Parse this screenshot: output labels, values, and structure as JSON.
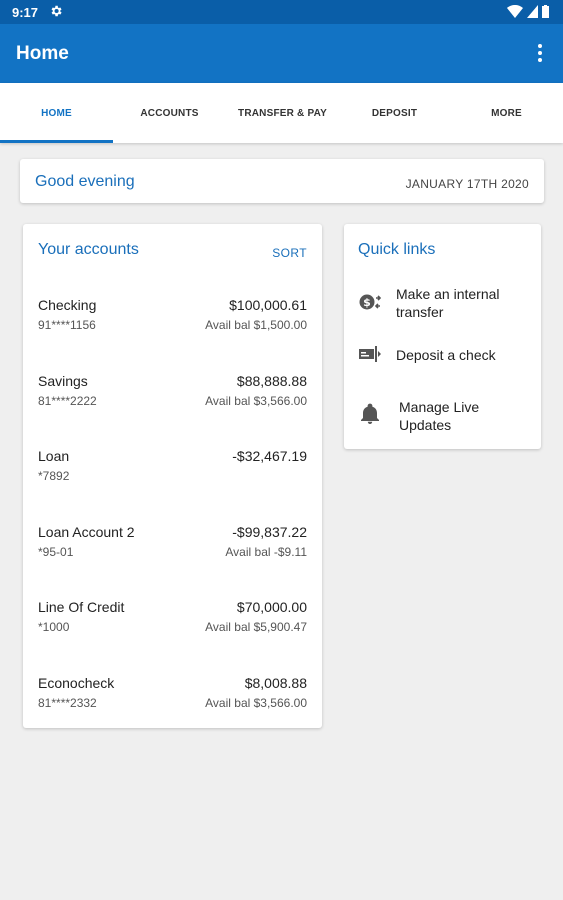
{
  "status_bar": {
    "time": "9:17"
  },
  "app_bar": {
    "title": "Home"
  },
  "tabs": [
    {
      "label": "HOME"
    },
    {
      "label": "ACCOUNTS"
    },
    {
      "label": "TRANSFER & PAY"
    },
    {
      "label": "DEPOSIT"
    },
    {
      "label": "MORE"
    }
  ],
  "greeting": {
    "text": "Good evening",
    "date": "JANUARY 17TH 2020"
  },
  "accounts": {
    "title": "Your accounts",
    "sort_label": "SORT",
    "items": [
      {
        "name": "Checking",
        "number": "91****1156",
        "amount": "$100,000.61",
        "available": "Avail bal $1,500.00"
      },
      {
        "name": "Savings",
        "number": "81****2222",
        "amount": "$88,888.88",
        "available": "Avail bal $3,566.00"
      },
      {
        "name": "Loan",
        "number": "*7892",
        "amount": "-$32,467.19",
        "available": ""
      },
      {
        "name": "Loan Account 2",
        "number": "*95-01",
        "amount": "-$99,837.22",
        "available": "Avail bal -$9.11"
      },
      {
        "name": "Line Of Credit",
        "number": "*1000",
        "amount": "$70,000.00",
        "available": "Avail bal $5,900.47"
      },
      {
        "name": "Econocheck",
        "number": "81****2332",
        "amount": "$8,008.88",
        "available": "Avail bal $3,566.00"
      }
    ]
  },
  "quick_links": {
    "title": "Quick links",
    "items": [
      {
        "label": "Make an internal transfer",
        "icon": "transfer-icon"
      },
      {
        "label": "Deposit a check",
        "icon": "check-deposit-icon"
      },
      {
        "label": "Manage Live Updates",
        "icon": "bell-icon"
      }
    ]
  },
  "colors": {
    "primary": "#1273c4",
    "status_bar": "#0a5ea8",
    "accent_text": "#1a6fba",
    "background": "#efefef"
  }
}
